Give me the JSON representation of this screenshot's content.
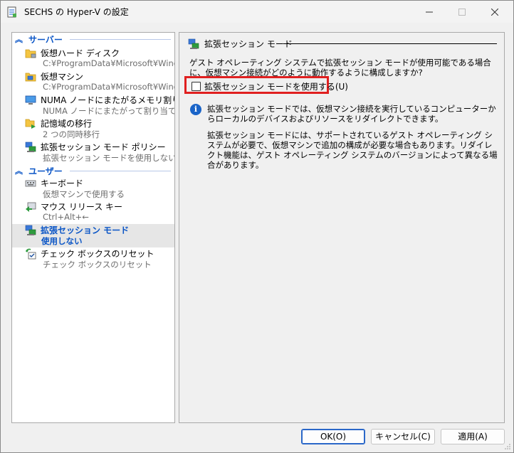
{
  "window": {
    "title": "SECHS の Hyper-V の設定",
    "title_icon": "settings-doc-icon"
  },
  "left_panel": {
    "sections": [
      {
        "header": "サーバー",
        "items": [
          {
            "icon": "hard-disk-folder-icon",
            "label": "仮想ハード ディスク",
            "sub": "C:¥ProgramData¥Microsoft¥Windo..."
          },
          {
            "icon": "vm-folder-icon",
            "label": "仮想マシン",
            "sub": "C:¥ProgramData¥Microsoft¥Windo..."
          },
          {
            "icon": "numa-monitor-icon",
            "label": "NUMA ノードにまたがるメモリ割り当て",
            "sub": "NUMA ノードにまたがって割り当てる"
          },
          {
            "icon": "storage-migration-icon",
            "label": "記憶域の移行",
            "sub": "2 つの同時移行"
          },
          {
            "icon": "session-network-icon",
            "label": "拡張セッション モード ポリシー",
            "sub": "拡張セッション モードを使用しない"
          }
        ]
      },
      {
        "header": "ユーザー",
        "items": [
          {
            "icon": "keyboard-icon",
            "label": "キーボード",
            "sub": "仮想マシンで使用する"
          },
          {
            "icon": "mouse-release-icon",
            "label": "マウス リリース キー",
            "sub": "Ctrl+Alt+←"
          },
          {
            "icon": "session-network-icon",
            "label": "拡張セッション モード",
            "sub": "使用しない",
            "selected": true
          },
          {
            "icon": "checkbox-reset-icon",
            "label": "チェック ボックスのリセット",
            "sub": "チェック ボックスのリセット"
          }
        ]
      }
    ]
  },
  "right_panel": {
    "title": "拡張セッション モード",
    "description": "ゲスト オペレーティング システムで拡張セッション モードが使用可能である場合に、仮想マシン接続がどのように動作するように構成しますか?",
    "checkbox_label": "拡張セッション モードを使用する(U)",
    "checkbox_checked": false,
    "info_paragraph_1": "拡張セッション モードでは、仮想マシン接続を実行しているコンピューターからローカルのデバイスおよびリソースをリダイレクトできます。",
    "info_paragraph_2": "拡張セッション モードには、サポートされているゲスト オペレーティング システムが必要で、仮想マシンで追加の構成が必要な場合もあります。リダイレクト機能は、ゲスト オペレーティング システムのバージョンによって異なる場合があります。"
  },
  "buttons": {
    "ok": "OK(O)",
    "cancel": "キャンセル(C)",
    "apply": "適用(A)"
  },
  "colors": {
    "accent": "#0a55c6",
    "highlight": "#e02020",
    "selected_bg": "#e6e6e6"
  }
}
